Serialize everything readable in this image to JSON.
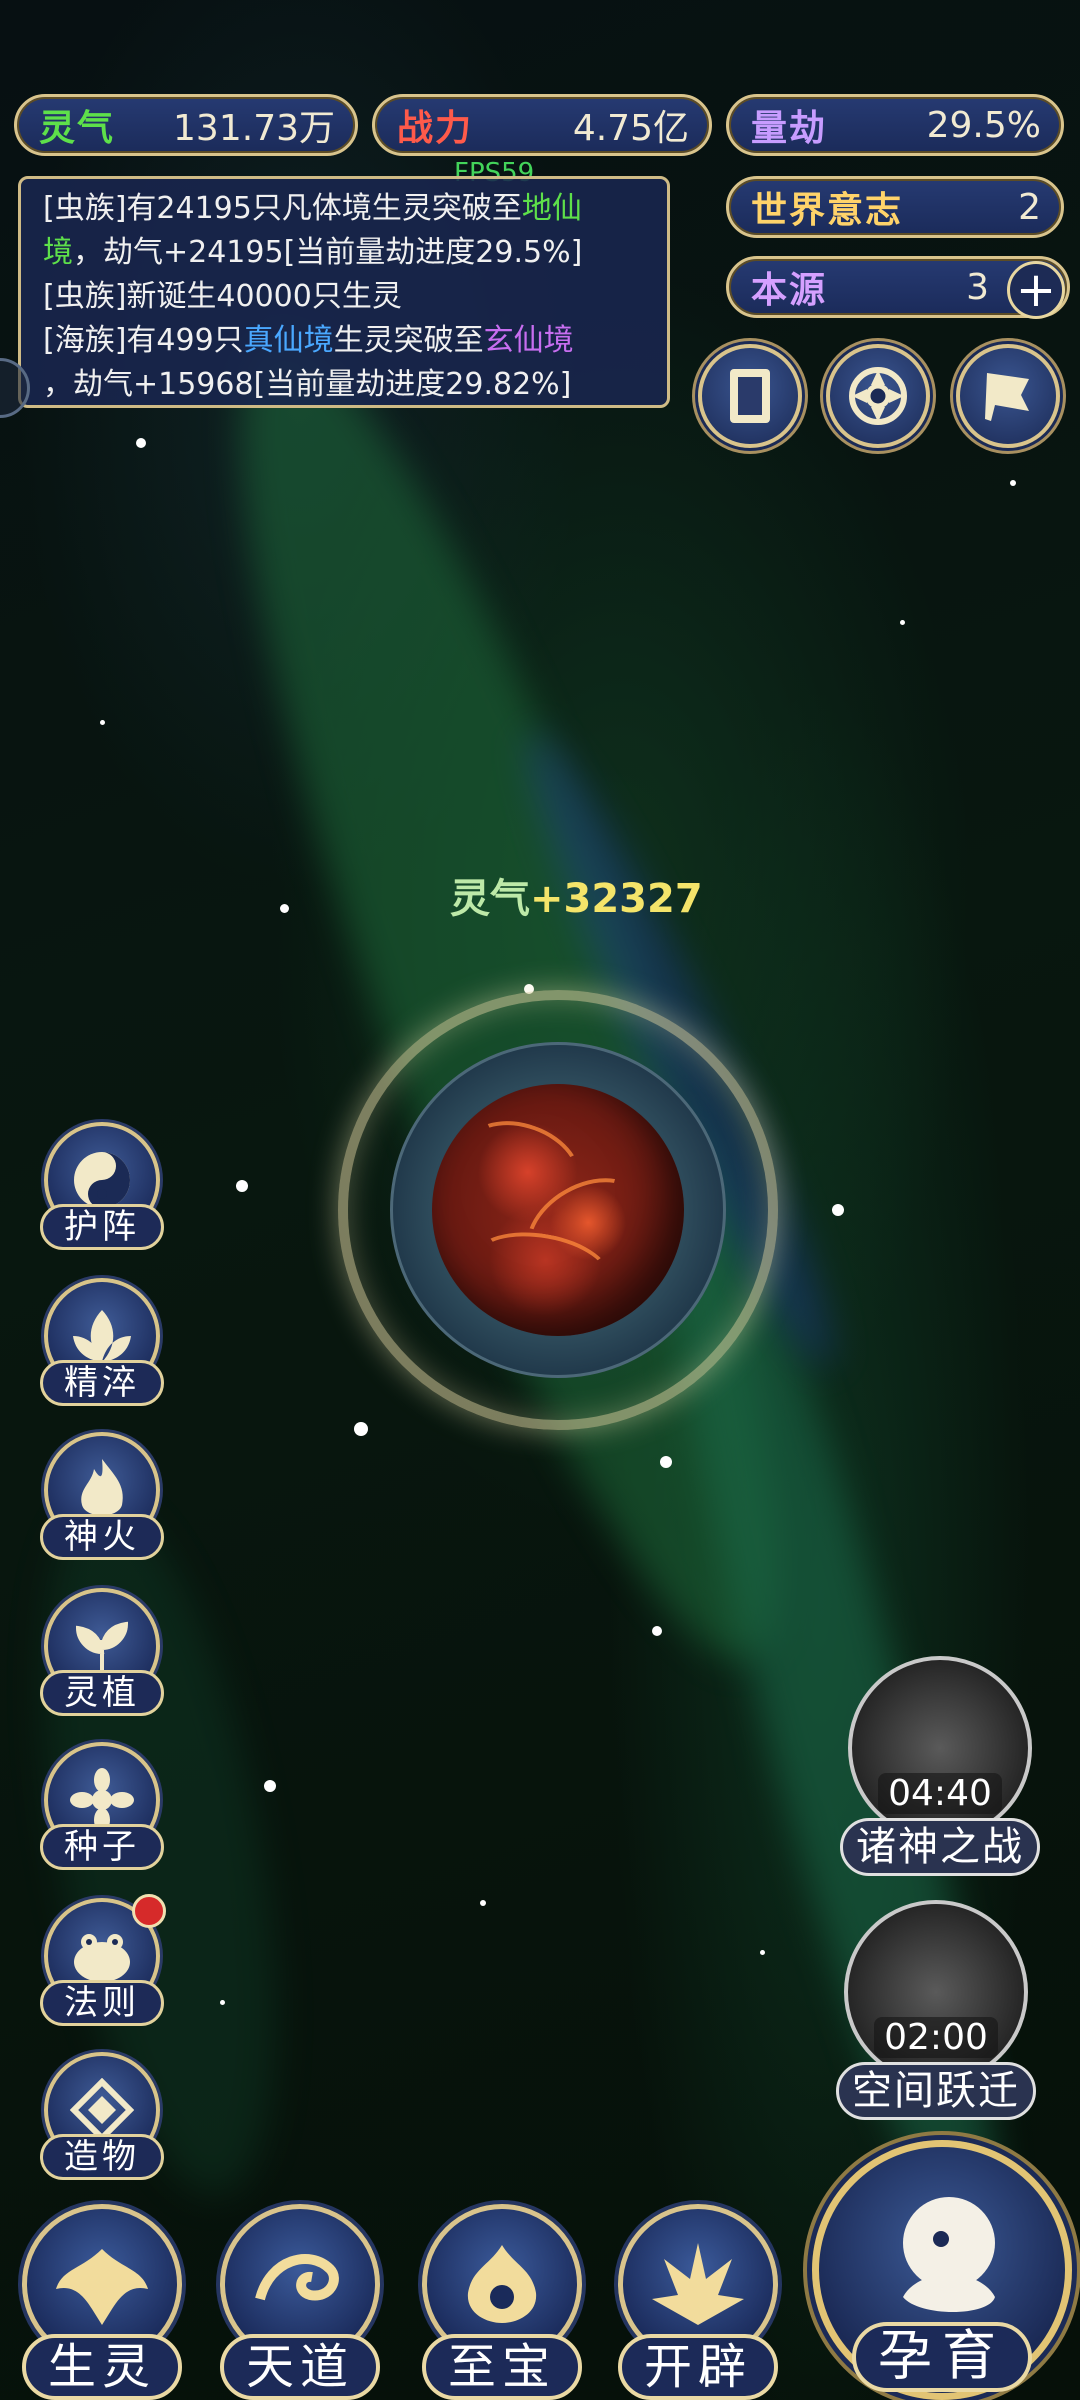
{
  "stats": {
    "lingqi": {
      "label": "灵气",
      "value": "131.73万",
      "color": "#5ee04a"
    },
    "zhanli": {
      "label": "战力",
      "value": "4.75亿",
      "color": "#ff5a4a"
    },
    "liangjie": {
      "label": "量劫",
      "value": "29.5%",
      "color": "#c79cff"
    },
    "shijie": {
      "label": "世界意志",
      "value": "2",
      "color": "#ffd36a"
    },
    "benyuan": {
      "label": "本源",
      "value": "3",
      "color": "#d5a0ff",
      "plus": "+"
    }
  },
  "fps": "FPS59",
  "log": [
    {
      "parts": [
        {
          "t": "[虫族]有24195只凡体境生灵突破至",
          "c": ""
        },
        {
          "t": "地仙",
          "c": "green"
        }
      ]
    },
    {
      "parts": [
        {
          "t": "境",
          "c": "green"
        },
        {
          "t": "，劫气+24195[当前量劫进度29.5%]",
          "c": ""
        }
      ]
    },
    {
      "parts": [
        {
          "t": "[虫族]新诞生40000只生灵",
          "c": ""
        }
      ]
    },
    {
      "parts": [
        {
          "t": "[海族]有499只",
          "c": ""
        },
        {
          "t": "真仙境",
          "c": "blue"
        },
        {
          "t": "生灵突破至",
          "c": ""
        },
        {
          "t": "玄仙境",
          "c": "purple"
        }
      ]
    },
    {
      "parts": [
        {
          "t": "，劫气+15968[当前量劫进度29.82%]",
          "c": ""
        }
      ]
    }
  ],
  "top_icons": [
    "scroll-icon",
    "vortex-icon",
    "flag-icon"
  ],
  "gain": {
    "label": "灵气",
    "value": "+32327"
  },
  "left_buttons": [
    {
      "label": "护阵",
      "icon": "yin-yang-icon",
      "badge": false
    },
    {
      "label": "精淬",
      "icon": "lotus-icon",
      "badge": false
    },
    {
      "label": "神火",
      "icon": "flame-icon",
      "badge": false
    },
    {
      "label": "灵植",
      "icon": "plant-icon",
      "badge": false
    },
    {
      "label": "种子",
      "icon": "seed-icon",
      "badge": false
    },
    {
      "label": "法则",
      "icon": "toad-icon",
      "badge": true
    },
    {
      "label": "造物",
      "icon": "diamond-icon",
      "badge": false
    }
  ],
  "timers": [
    {
      "label": "诸神之战",
      "time": "04:40",
      "icon": "sword-icon"
    },
    {
      "label": "空间跃迁",
      "time": "02:00",
      "icon": "portal-icon"
    }
  ],
  "bottom_nav": [
    {
      "label": "生灵",
      "icon": "phoenix-icon"
    },
    {
      "label": "天道",
      "icon": "wave-icon"
    },
    {
      "label": "至宝",
      "icon": "treasure-icon"
    },
    {
      "label": "开辟",
      "icon": "axe-icon"
    }
  ],
  "main_action": {
    "label": "孕育",
    "icon": "embryo-icon"
  }
}
